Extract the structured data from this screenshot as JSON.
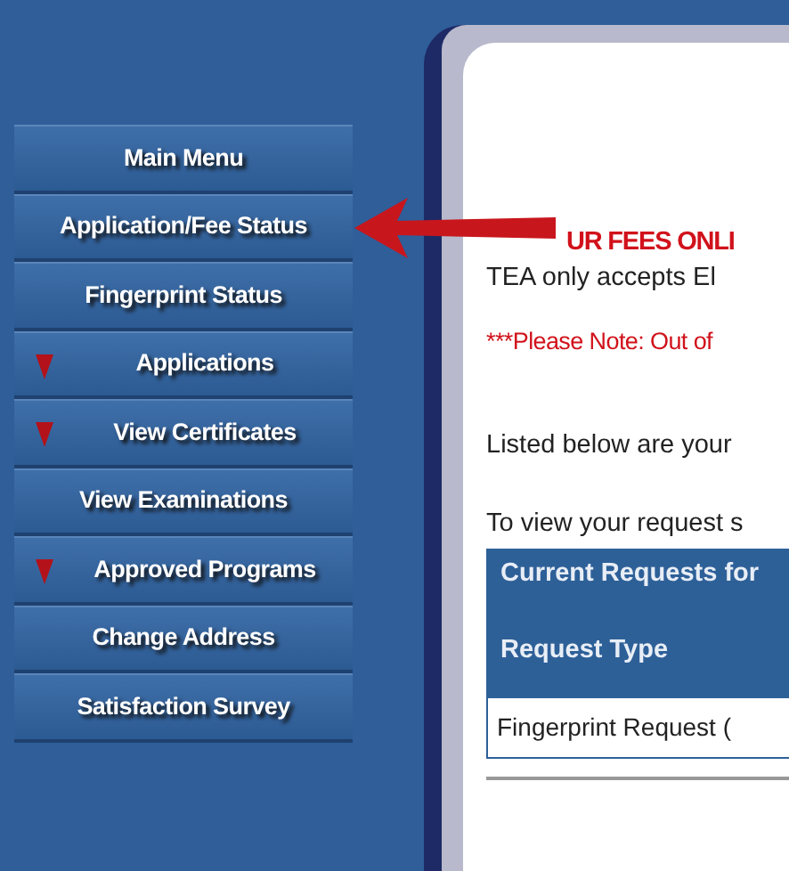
{
  "sidebar": {
    "items": [
      {
        "label": "Main Menu",
        "expandable": false
      },
      {
        "label": "Application/Fee Status",
        "expandable": false
      },
      {
        "label": "Fingerprint Status",
        "expandable": false
      },
      {
        "label": "Applications",
        "expandable": true
      },
      {
        "label": "View Certificates",
        "expandable": true
      },
      {
        "label": "View Examinations",
        "expandable": false
      },
      {
        "label": "Approved Programs",
        "expandable": true
      },
      {
        "label": "Change Address",
        "expandable": false
      },
      {
        "label": "Satisfaction Survey",
        "expandable": false
      }
    ]
  },
  "content": {
    "fees_heading": "UR FEES ONLI",
    "fees_text": "TEA only accepts El",
    "note": "***Please Note: Out of",
    "listed_text": "Listed below are your",
    "view_text": "To view your request s",
    "table": {
      "title": "Current Requests for",
      "columns": [
        "Request Type"
      ],
      "rows": [
        [
          "Fingerprint Request ("
        ]
      ]
    }
  }
}
